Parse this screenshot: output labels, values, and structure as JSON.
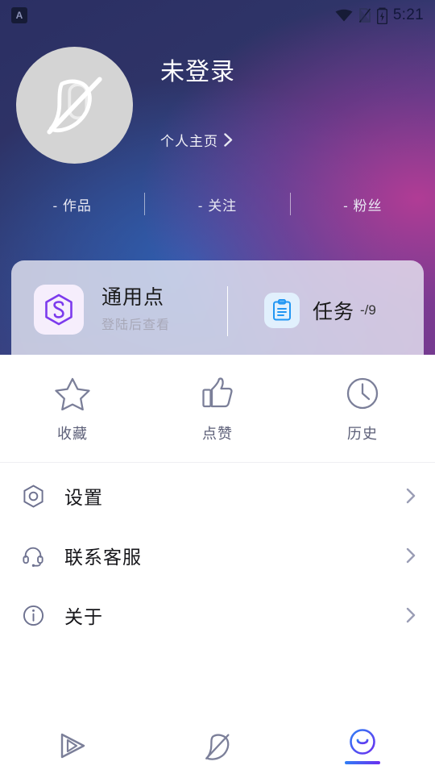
{
  "status_bar": {
    "notification_icon": "notification-badge-icon",
    "notification_letter": "A",
    "wifi_icon": "wifi-icon",
    "sim_icon": "sim-card-off-icon",
    "battery_icon": "battery-charging-icon",
    "time": "5:21"
  },
  "header": {
    "avatar_icon": "default-avatar-logo-icon",
    "nickname": "未登录",
    "home_link": "个人主页",
    "home_chevron_icon": "chevron-right-icon",
    "stats": [
      {
        "value": "-",
        "label": "作品"
      },
      {
        "value": "-",
        "label": "关注"
      },
      {
        "value": "-",
        "label": "粉丝"
      }
    ]
  },
  "points_card": {
    "points_icon": "hexagon-points-icon",
    "points_title": "通用点",
    "points_subtitle": "登陆后查看",
    "task_icon": "clipboard-task-icon",
    "task_label": "任务",
    "task_count": "-/9"
  },
  "quick_actions": [
    {
      "icon": "star-icon",
      "label": "收藏"
    },
    {
      "icon": "thumbs-up-icon",
      "label": "点赞"
    },
    {
      "icon": "clock-history-icon",
      "label": "历史"
    }
  ],
  "menu": [
    {
      "icon": "settings-hexagon-icon",
      "label": "设置",
      "arrow": "chevron-right-icon"
    },
    {
      "icon": "headset-support-icon",
      "label": "联系客服",
      "arrow": "chevron-right-icon"
    },
    {
      "icon": "info-circle-icon",
      "label": "关于",
      "arrow": "chevron-right-icon"
    }
  ],
  "bottom_nav": [
    {
      "icon": "play-triangle-icon",
      "active": false
    },
    {
      "icon": "leaf-logo-icon",
      "active": false
    },
    {
      "icon": "smiley-profile-icon",
      "active": true
    }
  ],
  "colors": {
    "gradient_start": "#2b2f63",
    "gradient_mid": "#2e60b2",
    "gradient_end": "#6a3c8e",
    "accent_blue": "#2f7ef5",
    "accent_purple": "#6a2ff0",
    "points_purple": "#7c3aed",
    "task_blue": "#2196f3",
    "icon_gray": "#7b7f99",
    "card_bg": "#e8e8f4"
  }
}
